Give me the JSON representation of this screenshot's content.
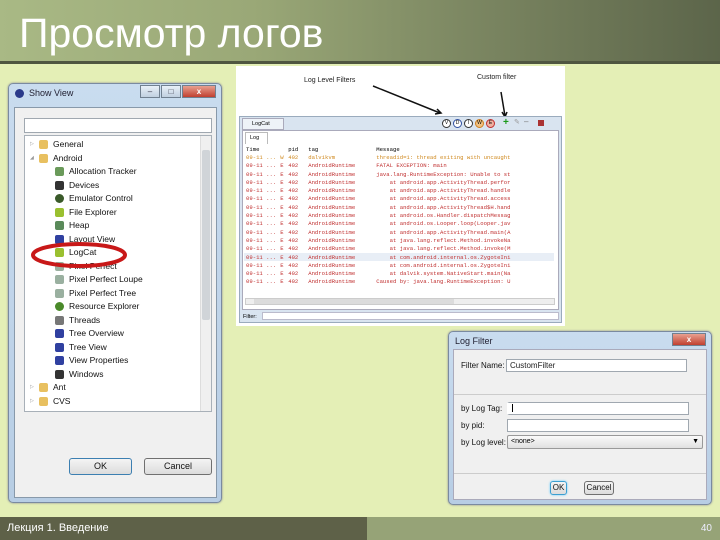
{
  "slide": {
    "title": "Просмотр логов",
    "footer": "Лекция 1. Введение",
    "page_number": "40"
  },
  "show_view": {
    "title": "Show View",
    "search_value": "",
    "ok": "OK",
    "cancel": "Cancel",
    "items": [
      {
        "label": "General",
        "level": 0,
        "icon": "folder-icon"
      },
      {
        "label": "Android",
        "level": 0,
        "icon": "folder-icon"
      },
      {
        "label": "Allocation Tracker",
        "level": 1,
        "icon": "allocation-tracker-icon"
      },
      {
        "label": "Devices",
        "level": 1,
        "icon": "device-icon"
      },
      {
        "label": "Emulator Control",
        "level": 1,
        "icon": "emulator-control-icon"
      },
      {
        "label": "File Explorer",
        "level": 1,
        "icon": "android-icon"
      },
      {
        "label": "Heap",
        "level": 1,
        "icon": "heap-icon"
      },
      {
        "label": "Layout View",
        "level": 1,
        "icon": "hierarchy-icon"
      },
      {
        "label": "LogCat",
        "level": 1,
        "icon": "android-icon"
      },
      {
        "label": "Pixel Perfect",
        "level": 1,
        "icon": "magnifier-icon"
      },
      {
        "label": "Pixel Perfect Loupe",
        "level": 1,
        "icon": "magnifier-icon"
      },
      {
        "label": "Pixel Perfect Tree",
        "level": 1,
        "icon": "magnifier-icon"
      },
      {
        "label": "Resource Explorer",
        "level": 1,
        "icon": "resource-icon"
      },
      {
        "label": "Threads",
        "level": 1,
        "icon": "threads-icon"
      },
      {
        "label": "Tree Overview",
        "level": 1,
        "icon": "hierarchy-icon"
      },
      {
        "label": "Tree View",
        "level": 1,
        "icon": "hierarchy-icon"
      },
      {
        "label": "View Properties",
        "level": 1,
        "icon": "hierarchy-icon"
      },
      {
        "label": "Windows",
        "level": 1,
        "icon": "device-icon"
      },
      {
        "label": "Ant",
        "level": 0,
        "icon": "folder-icon"
      },
      {
        "label": "CVS",
        "level": 0,
        "icon": "folder-icon"
      }
    ]
  },
  "logcat": {
    "annotation_levels": "Log Level Filters",
    "annotation_custom": "Custom filter",
    "view_tab": "LogCat",
    "log_tab": "Log",
    "filter_label": "Filter:",
    "filter_value": "",
    "level_buttons": [
      "V",
      "D",
      "I",
      "W",
      "E"
    ],
    "columns": [
      "Time",
      "",
      "pid",
      "tag",
      "Message"
    ],
    "rows": [
      [
        "09-11 ...",
        "W",
        "402",
        "dalvikvm",
        "threadid=1: thread exiting with uncaught"
      ],
      [
        "09-11 ...",
        "E",
        "402",
        "AndroidRuntime",
        "FATAL EXCEPTION: main"
      ],
      [
        "09-11 ...",
        "E",
        "402",
        "AndroidRuntime",
        "java.lang.RuntimeException: Unable to st"
      ],
      [
        "09-11 ...",
        "E",
        "402",
        "AndroidRuntime",
        "    at android.app.ActivityThread.perfor"
      ],
      [
        "09-11 ...",
        "E",
        "402",
        "AndroidRuntime",
        "    at android.app.ActivityThread.handle"
      ],
      [
        "09-11 ...",
        "E",
        "402",
        "AndroidRuntime",
        "    at android.app.ActivityThread.access"
      ],
      [
        "09-11 ...",
        "E",
        "402",
        "AndroidRuntime",
        "    at android.app.ActivityThread$H.hand"
      ],
      [
        "09-11 ...",
        "E",
        "402",
        "AndroidRuntime",
        "    at android.os.Handler.dispatchMessag"
      ],
      [
        "09-11 ...",
        "E",
        "402",
        "AndroidRuntime",
        "    at android.os.Looper.loop(Looper.jav"
      ],
      [
        "09-11 ...",
        "E",
        "402",
        "AndroidRuntime",
        "    at android.app.ActivityThread.main(A"
      ],
      [
        "09-11 ...",
        "E",
        "402",
        "AndroidRuntime",
        "    at java.lang.reflect.Method.invokeNa"
      ],
      [
        "09-11 ...",
        "E",
        "402",
        "AndroidRuntime",
        "    at java.lang.reflect.Method.invoke(M"
      ],
      [
        "09-11 ...",
        "E",
        "402",
        "AndroidRuntime",
        "    at com.android.internal.os.ZygoteIni"
      ],
      [
        "09-11 ...",
        "E",
        "402",
        "AndroidRuntime",
        "    at com.android.internal.os.ZygoteIni"
      ],
      [
        "09-11 ...",
        "E",
        "402",
        "AndroidRuntime",
        "    at dalvik.system.NativeStart.main(Na"
      ],
      [
        "09-11 ...",
        "E",
        "402",
        "AndroidRuntime",
        "Caused by: java.lang.RuntimeException: U"
      ]
    ]
  },
  "log_filter": {
    "title": "Log Filter",
    "filter_name_label": "Filter Name:",
    "filter_name_value": "CustomFilter",
    "tag_label": "by Log Tag:",
    "tag_value": "",
    "pid_label": "by pid:",
    "pid_value": "",
    "level_label": "by Log level:",
    "level_value": "<none>",
    "ok": "OK",
    "cancel": "Cancel"
  },
  "colors": {
    "error": "#c03030",
    "warning": "#d08a20",
    "highlight_ellipse": "#c81818"
  }
}
